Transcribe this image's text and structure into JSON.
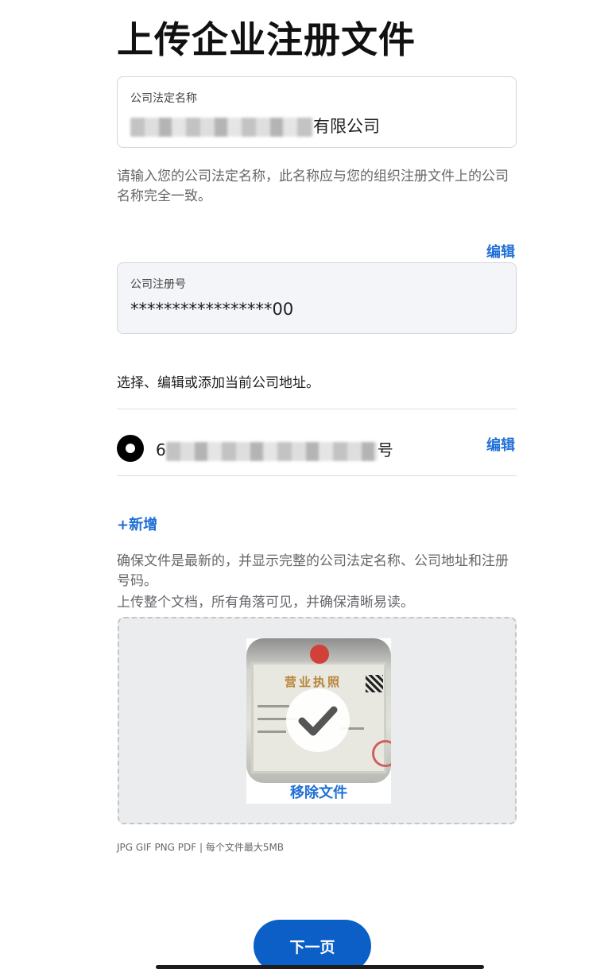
{
  "page": {
    "title": "上传企业注册文件"
  },
  "legal_name": {
    "label": "公司法定名称",
    "value_suffix": "有限公司",
    "help": "请输入您的公司法定名称，此名称应与您的组织注册文件上的公司名称完全一致。"
  },
  "registration": {
    "edit_label": "编辑",
    "label": "公司注册号",
    "value": "*****************00"
  },
  "address_section": {
    "label": "选择、编辑或添加当前公司地址。",
    "address_prefix": "6",
    "address_suffix": "号",
    "edit_label": "编辑",
    "add_label": "+新增"
  },
  "upload": {
    "instructions_1": "确保文件是最新的，并显示完整的公司法定名称、公司地址和注册号码。",
    "instructions_2": "上传整个文档，所有角落可见，并确保清晰易读。",
    "doc_title": "营业执照",
    "remove_label": "移除文件",
    "formats": "JPG GIF PNG PDF | 每个文件最大5MB"
  },
  "footer": {
    "next_label": "下一页"
  },
  "colors": {
    "link": "#1f6fd6",
    "primary_button": "#0b5fc6"
  }
}
